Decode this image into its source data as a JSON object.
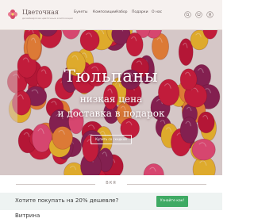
{
  "header": {
    "logo_title": "Цветочная",
    "logo_subtitle": "дизайнерские цветочные композиции",
    "nav": [
      "Букеты",
      "Композиции",
      "Набор",
      "Подарки",
      "О нас"
    ],
    "icons": [
      "search-icon",
      "cart-icon",
      "user-icon"
    ]
  },
  "hero": {
    "title": "Тюльпаны",
    "subtitle_line1": "низкая цена",
    "subtitle_line2": "и доставка в подарок",
    "button_label": "Купить со скидкой"
  },
  "divider": {
    "label": "ВКЯ"
  },
  "promo": {
    "text": "Хотите покупать на 20% дешевле?",
    "button_label": "Узнайте как!"
  },
  "section": {
    "title": "Витрина"
  },
  "colors": {
    "topbar": "#f6f1ef",
    "promo_bg": "#eef3f2",
    "promo_button": "#3faa64",
    "tulip_red": "#d11f3f",
    "tulip_yellow": "#f2c12e",
    "tulip_pink": "#e94f7a",
    "tulip_purple": "#8a2457"
  }
}
